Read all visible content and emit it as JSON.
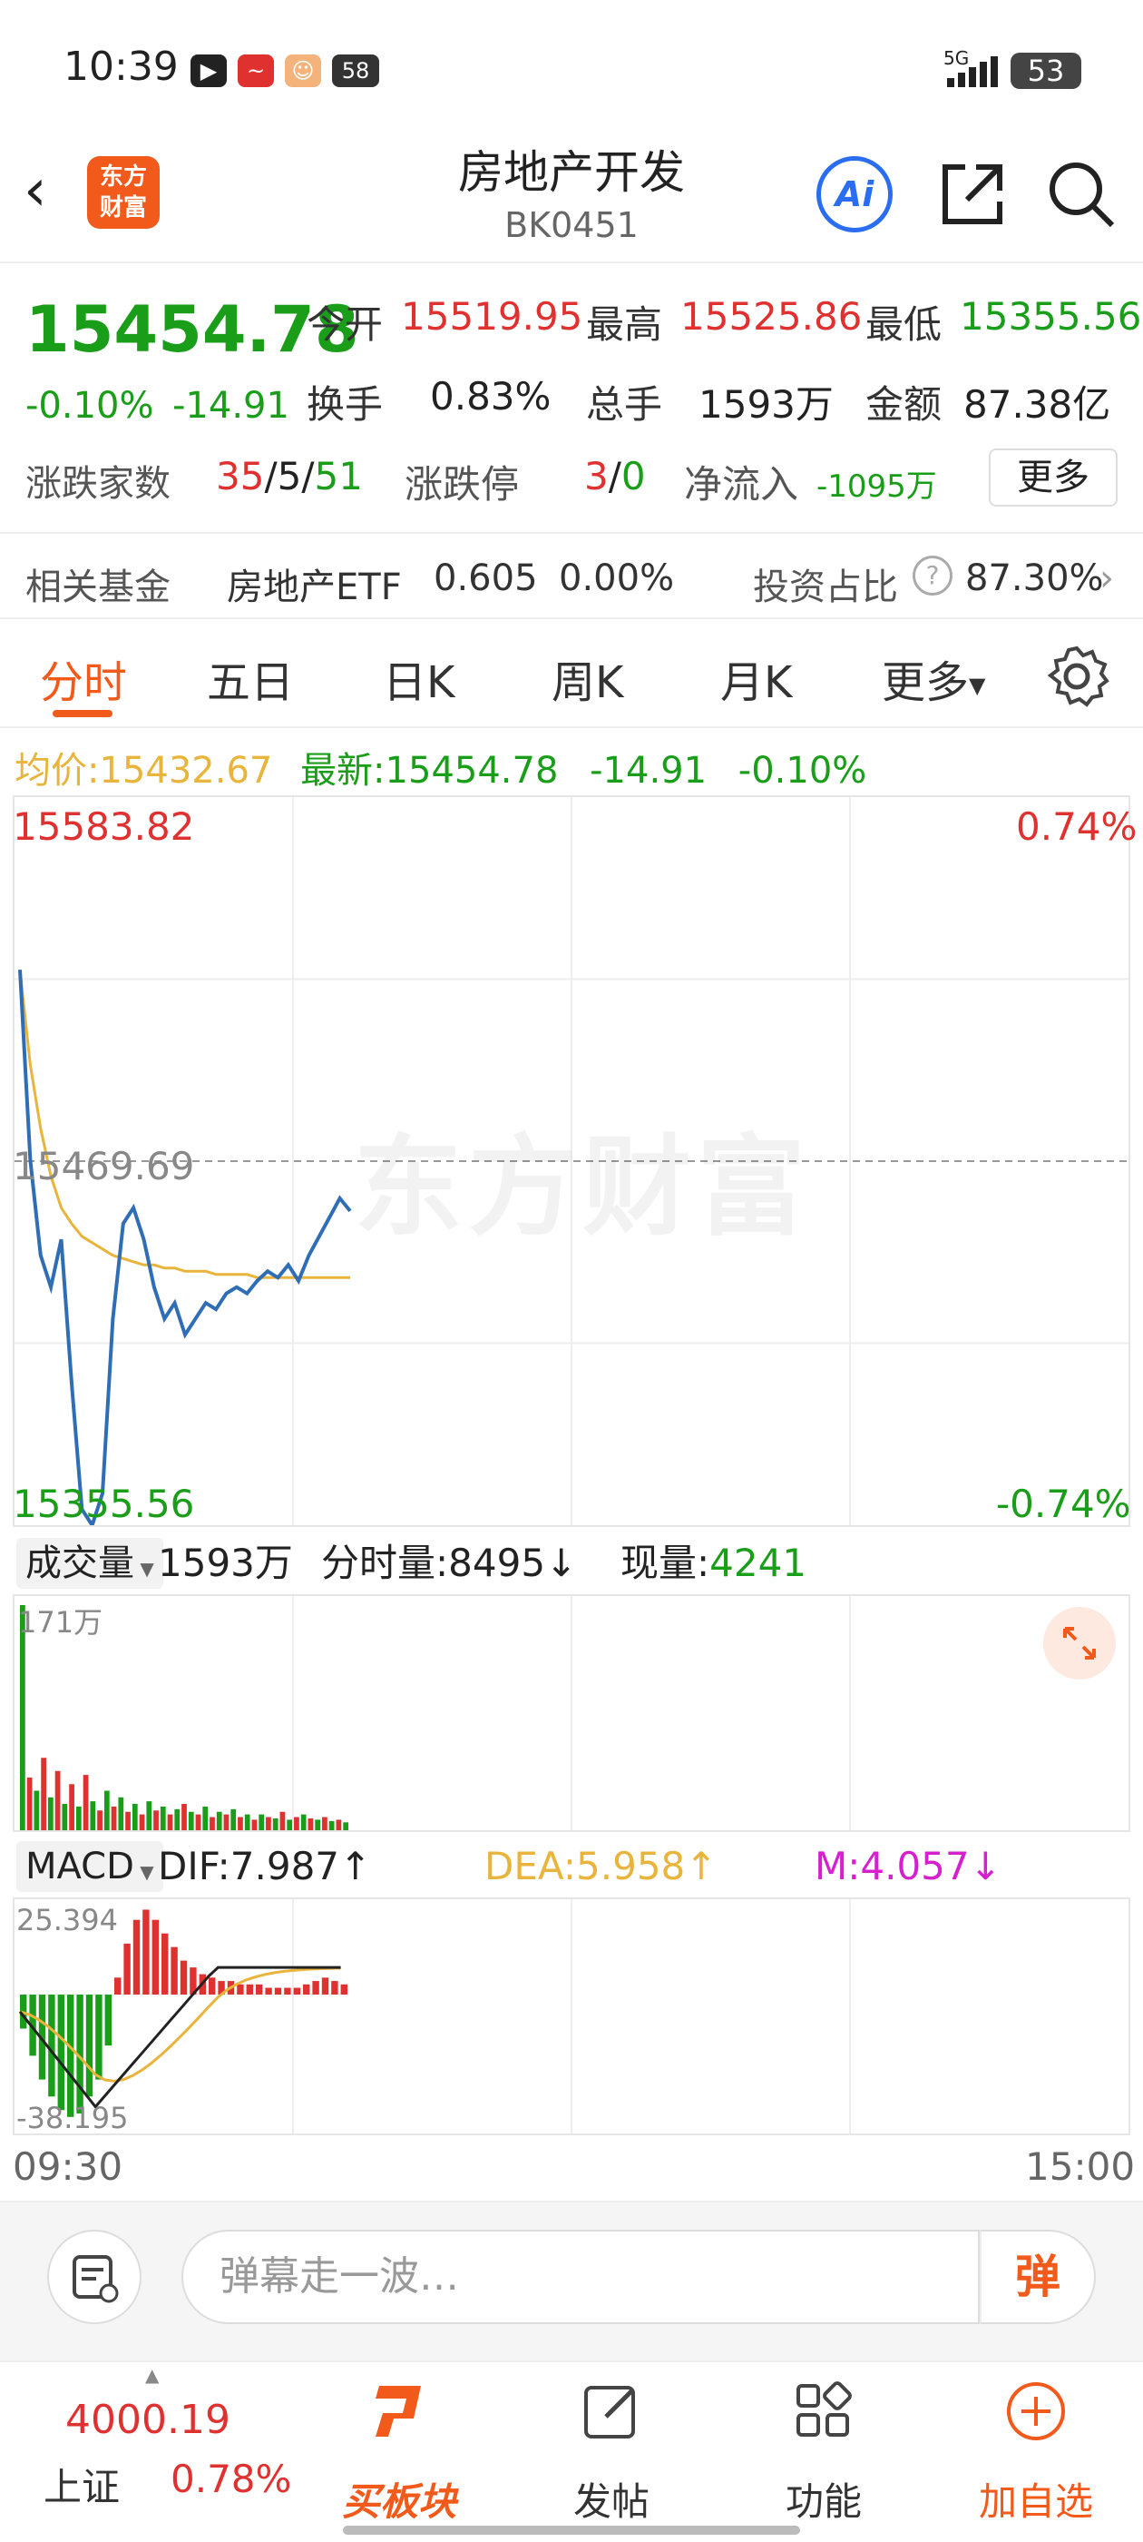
{
  "status_bar": {
    "time": "10:39",
    "app_badge": "58",
    "network": "5G",
    "battery": "53"
  },
  "header": {
    "logo_text_line1": "东方",
    "logo_text_line2": "财富",
    "title": "房地产开发",
    "code": "BK0451",
    "ai_label": "Ai"
  },
  "quote": {
    "price": "15454.78",
    "change_pct": "-0.10%",
    "change": "-14.91",
    "open_label": "今开",
    "open": "15519.95",
    "high_label": "最高",
    "high": "15525.86",
    "low_label": "最低",
    "low": "15355.56",
    "turnover_label": "换手",
    "turnover": "0.83%",
    "volume_label": "总手",
    "volume": "1593万",
    "amount_label": "金额",
    "amount": "87.38亿",
    "breadth_label": "涨跌家数",
    "up": "35",
    "flat": "5",
    "down": "51",
    "limit_label": "涨跌停",
    "limit_up": "3",
    "limit_down": "0",
    "inflow_label": "净流入",
    "inflow": "-1095万",
    "more_label": "更多"
  },
  "fund": {
    "label": "相关基金",
    "name": "房地产ETF",
    "price": "0.605",
    "change": "0.00%",
    "ratio_label": "投资占比",
    "ratio": "87.30%"
  },
  "tabs": [
    "分时",
    "五日",
    "日K",
    "周K",
    "月K",
    "更多"
  ],
  "info_line": {
    "avg_label": "均价:",
    "avg": "15432.67",
    "latest_label": "最新:",
    "latest": "15454.78",
    "chg": "-14.91",
    "pct": "-0.10%"
  },
  "chart_data": {
    "type": "line",
    "y_max": "15583.82",
    "y_mid": "15469.69",
    "y_min": "15355.56",
    "pct_max": "0.74%",
    "pct_min": "-0.74%",
    "ylim": [
      15355.56,
      15583.82
    ],
    "watermark": "东方财富",
    "series": [
      {
        "values": [
          15530,
          15470,
          15440,
          15430,
          15445,
          15400,
          15360,
          15355,
          15365,
          15420,
          15450,
          15455,
          15445,
          15430,
          15420,
          15425,
          15415,
          15420,
          15425,
          15423,
          15428,
          15430,
          15428,
          15432,
          15435,
          15433,
          15437,
          15432,
          15440,
          15446,
          15452,
          15458,
          15454
        ]
      },
      {
        "values": [
          15530,
          15500,
          15480,
          15465,
          15455,
          15450,
          15446,
          15444,
          15442,
          15440,
          15439,
          15438,
          15437,
          15437,
          15436,
          15436,
          15435,
          15435,
          15435,
          15434,
          15434,
          15434,
          15434,
          15433,
          15433,
          15433,
          15433,
          15433,
          15433,
          15433,
          15433,
          15433,
          15433
        ]
      }
    ],
    "time_start": "09:30",
    "time_end": "15:00"
  },
  "volume": {
    "select_label": "成交量",
    "total": "1593万",
    "bar_label": "分时量:8495",
    "now_label": "现量:",
    "now": "4241",
    "ymax": "171万",
    "bars": [
      171,
      40,
      30,
      55,
      25,
      45,
      20,
      35,
      18,
      42,
      22,
      15,
      30,
      18,
      25,
      14,
      20,
      12,
      22,
      15,
      18,
      12,
      16,
      20,
      14,
      12,
      18,
      10,
      14,
      12,
      16,
      10,
      12,
      8,
      12,
      10,
      9,
      14,
      8,
      10,
      12,
      9,
      8,
      10,
      7,
      8,
      6
    ],
    "colors": [
      "g",
      "r",
      "g",
      "r",
      "g",
      "r",
      "g",
      "r",
      "g",
      "r",
      "g",
      "r",
      "g",
      "r",
      "g",
      "r",
      "g",
      "r",
      "g",
      "r",
      "g",
      "r",
      "g",
      "r",
      "g",
      "r",
      "g",
      "r",
      "g",
      "r",
      "g",
      "r",
      "g",
      "r",
      "g",
      "r",
      "g",
      "r",
      "g",
      "r",
      "g",
      "r",
      "g",
      "r",
      "g",
      "r",
      "g"
    ]
  },
  "macd": {
    "select_label": "MACD",
    "dif": "DIF:7.987",
    "dea": "DEA:5.958",
    "m": "M:4.057",
    "ymax": "25.394",
    "ymin": "-38.195",
    "hist": [
      -10,
      -18,
      -25,
      -30,
      -34,
      -36,
      -35,
      -30,
      -25,
      -15,
      5,
      15,
      22,
      25,
      22,
      18,
      14,
      10,
      8,
      6,
      5,
      4,
      4,
      3,
      3,
      3,
      2,
      2,
      2,
      2,
      3,
      4,
      5,
      4,
      3
    ]
  },
  "comment": {
    "placeholder": "弹幕走一波…",
    "danmu_label": "弹"
  },
  "bottom_nav": {
    "index_value": "4000.19",
    "index_name": "上证",
    "index_pct": "0.78%",
    "items": [
      "买板块",
      "发帖",
      "功能",
      "加自选"
    ]
  },
  "colors": {
    "accent": "#f25a1c",
    "up": "#e03131",
    "down": "#1a9e1a",
    "price_line": "#2f6db4",
    "avg_line": "#e9b43c"
  }
}
